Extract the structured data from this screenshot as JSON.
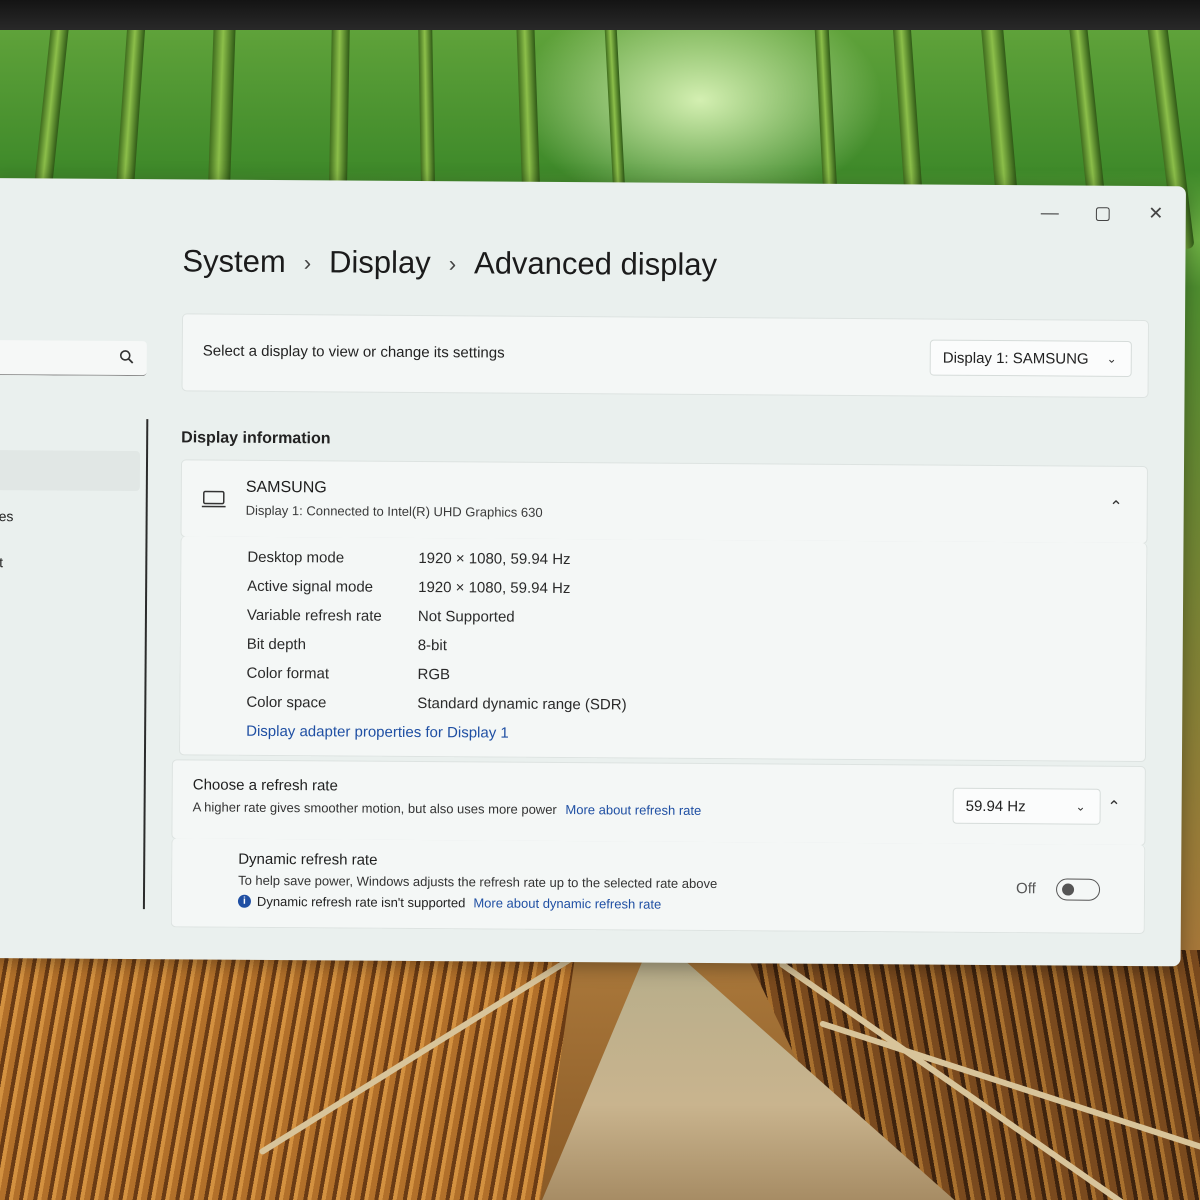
{
  "window": {
    "controls": {
      "minimize": "—",
      "maximize": "▢",
      "close": "✕"
    }
  },
  "sidebar": {
    "items": [
      {
        "label": "ces"
      },
      {
        "label": "et"
      }
    ]
  },
  "breadcrumb": {
    "items": [
      "System",
      "Display",
      "Advanced display"
    ],
    "separator": "›"
  },
  "display_select": {
    "prompt": "Select a display to view or change its settings",
    "selected": "Display 1: SAMSUNG"
  },
  "display_information": {
    "heading": "Display information",
    "monitor_name": "SAMSUNG",
    "monitor_subtitle": "Display 1: Connected to Intel(R) UHD Graphics 630",
    "rows": [
      {
        "label": "Desktop mode",
        "value": "1920 × 1080, 59.94 Hz"
      },
      {
        "label": "Active signal mode",
        "value": "1920 × 1080, 59.94 Hz"
      },
      {
        "label": "Variable refresh rate",
        "value": "Not Supported"
      },
      {
        "label": "Bit depth",
        "value": "8-bit"
      },
      {
        "label": "Color format",
        "value": "RGB"
      },
      {
        "label": "Color space",
        "value": "Standard dynamic range (SDR)"
      }
    ],
    "adapter_link": "Display adapter properties for Display 1"
  },
  "refresh_rate": {
    "title": "Choose a refresh rate",
    "description": "A higher rate gives smoother motion, but also uses more power",
    "link": "More about refresh rate",
    "selected": "59.94 Hz"
  },
  "dynamic_refresh": {
    "title": "Dynamic refresh rate",
    "description": "To help save power, Windows adjusts the refresh rate up to the selected rate above",
    "notice": "Dynamic refresh rate isn't supported",
    "link": "More about dynamic refresh rate",
    "toggle_state": "Off",
    "toggle_on": false
  },
  "colors": {
    "link": "#1f4fa3",
    "window_bg": "#eaf0ee",
    "card_bg": "#f4f7f6",
    "info_icon": "#1f4fa3"
  }
}
